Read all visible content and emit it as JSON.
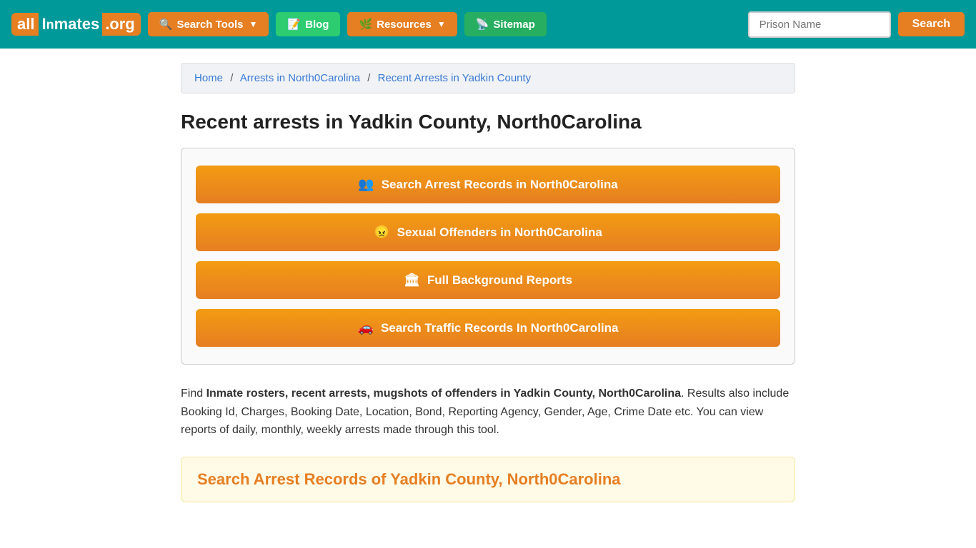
{
  "nav": {
    "logo": {
      "all": "all",
      "inmates": "Inmates",
      "org": ".org"
    },
    "search_tools_label": "Search Tools",
    "blog_label": "Blog",
    "resources_label": "Resources",
    "sitemap_label": "Sitemap",
    "prison_name_placeholder": "Prison Name",
    "search_button_label": "Search"
  },
  "breadcrumb": {
    "home": "Home",
    "arrests": "Arrests in North0Carolina",
    "current": "Recent Arrests in Yadkin County"
  },
  "page": {
    "title": "Recent arrests in Yadkin County, North0Carolina"
  },
  "buttons": [
    {
      "icon": "👥",
      "label": "Search Arrest Records in North0Carolina"
    },
    {
      "icon": "😠",
      "label": "Sexual Offenders in North0Carolina"
    },
    {
      "icon": "🏛",
      "label": "Full Background Reports"
    },
    {
      "icon": "🚗",
      "label": "Search Traffic Records In North0Carolina"
    }
  ],
  "description": {
    "intro": "Find ",
    "bold_part": "Inmate rosters, recent arrests, mugshots of offenders in Yadkin County, North0Carolina",
    "rest": ". Results also include Booking Id, Charges, Booking Date, Location, Bond, Reporting Agency, Gender, Age, Crime Date etc. You can view reports of daily, monthly, weekly arrests made through this tool."
  },
  "search_section": {
    "title": "Search Arrest Records of Yadkin County, North0Carolina"
  }
}
